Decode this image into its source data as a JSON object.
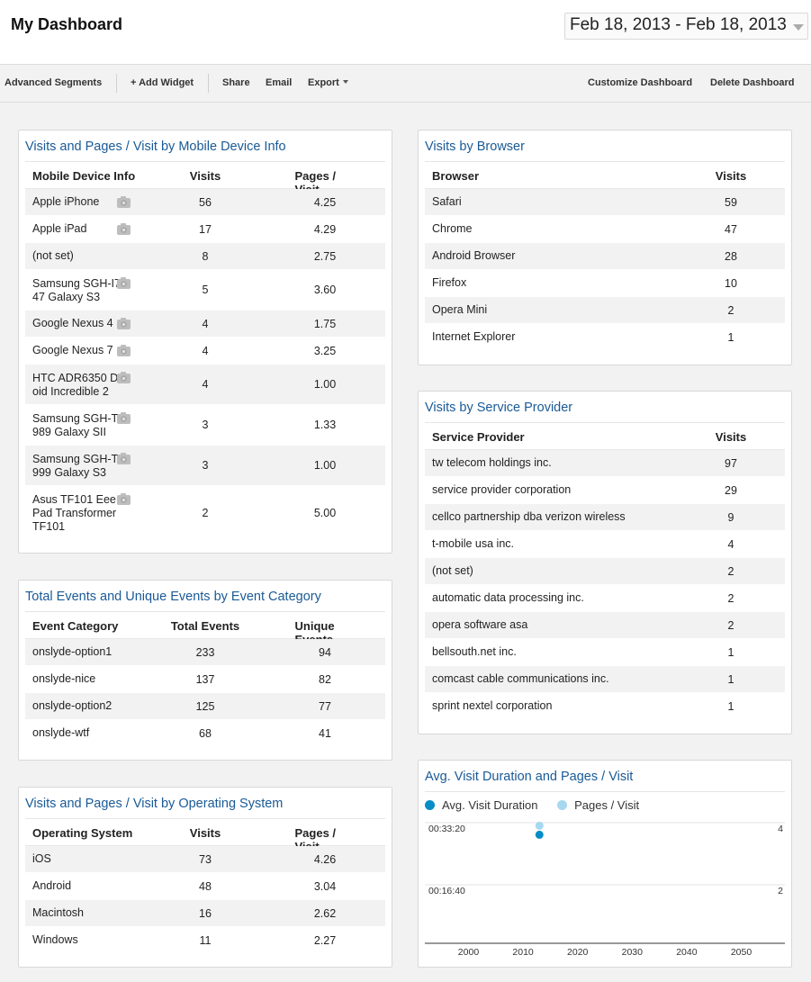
{
  "header": {
    "title": "My Dashboard",
    "date_range": "Feb 18, 2013 - Feb 18, 2013"
  },
  "toolbar": {
    "advanced_segments": "Advanced Segments",
    "add_widget": "+ Add Widget",
    "share": "Share",
    "email": "Email",
    "export": "Export",
    "customize": "Customize Dashboard",
    "delete": "Delete Dashboard"
  },
  "widgets": {
    "mobile": {
      "title": "Visits and Pages / Visit by Mobile Device Info",
      "headers": [
        "Mobile Device Info",
        "Visits",
        "Pages / Visit"
      ],
      "rows": [
        {
          "name": [
            "Apple iPhone"
          ],
          "visits": "56",
          "ppv": "4.25",
          "camera": true
        },
        {
          "name": [
            "Apple iPad"
          ],
          "visits": "17",
          "ppv": "4.29",
          "camera": true
        },
        {
          "name": [
            "(not set)"
          ],
          "visits": "8",
          "ppv": "2.75",
          "camera": false
        },
        {
          "name": [
            "Samsung SGH-I7",
            "47 Galaxy S3"
          ],
          "visits": "5",
          "ppv": "3.60",
          "camera": true
        },
        {
          "name": [
            "Google Nexus 4"
          ],
          "visits": "4",
          "ppv": "1.75",
          "camera": true
        },
        {
          "name": [
            "Google Nexus 7"
          ],
          "visits": "4",
          "ppv": "3.25",
          "camera": true
        },
        {
          "name": [
            "HTC ADR6350 Dr",
            "oid Incredible 2"
          ],
          "visits": "4",
          "ppv": "1.00",
          "camera": true
        },
        {
          "name": [
            "Samsung SGH-T",
            "989 Galaxy SII"
          ],
          "visits": "3",
          "ppv": "1.33",
          "camera": true
        },
        {
          "name": [
            "Samsung SGH-T",
            "999 Galaxy S3"
          ],
          "visits": "3",
          "ppv": "1.00",
          "camera": true
        },
        {
          "name": [
            "Asus TF101 Eee",
            "Pad Transformer",
            "TF101"
          ],
          "visits": "2",
          "ppv": "5.00",
          "camera": true
        }
      ]
    },
    "events": {
      "title": "Total Events and Unique Events by Event Category",
      "headers": [
        "Event Category",
        "Total Events",
        "Unique Events"
      ],
      "rows": [
        {
          "name": [
            "onslyde-option1"
          ],
          "total": "233",
          "unique": "94"
        },
        {
          "name": [
            "onslyde-nice"
          ],
          "total": "137",
          "unique": "82"
        },
        {
          "name": [
            "onslyde-option2"
          ],
          "total": "125",
          "unique": "77"
        },
        {
          "name": [
            "onslyde-wtf"
          ],
          "total": "68",
          "unique": "41"
        }
      ]
    },
    "os": {
      "title": "Visits and Pages / Visit by Operating System",
      "headers": [
        "Operating System",
        "Visits",
        "Pages / Visit"
      ],
      "rows": [
        {
          "name": [
            "iOS"
          ],
          "visits": "73",
          "ppv": "4.26"
        },
        {
          "name": [
            "Android"
          ],
          "visits": "48",
          "ppv": "3.04"
        },
        {
          "name": [
            "Macintosh"
          ],
          "visits": "16",
          "ppv": "2.62"
        },
        {
          "name": [
            "Windows"
          ],
          "visits": "11",
          "ppv": "2.27"
        }
      ]
    },
    "browser": {
      "title": "Visits by Browser",
      "headers": [
        "Browser",
        "Visits"
      ],
      "rows": [
        {
          "name": [
            "Safari"
          ],
          "visits": "59"
        },
        {
          "name": [
            "Chrome"
          ],
          "visits": "47"
        },
        {
          "name": [
            "Android Browser"
          ],
          "visits": "28"
        },
        {
          "name": [
            "Firefox"
          ],
          "visits": "10"
        },
        {
          "name": [
            "Opera Mini"
          ],
          "visits": "2"
        },
        {
          "name": [
            "Internet Explorer"
          ],
          "visits": "1"
        }
      ]
    },
    "provider": {
      "title": "Visits by Service Provider",
      "headers": [
        "Service Provider",
        "Visits"
      ],
      "rows": [
        {
          "name": [
            "tw telecom holdings inc."
          ],
          "visits": "97"
        },
        {
          "name": [
            "service provider corporation"
          ],
          "visits": "29"
        },
        {
          "name": [
            "cellco partnership dba verizon wireless"
          ],
          "visits": "9"
        },
        {
          "name": [
            "t-mobile usa inc."
          ],
          "visits": "4"
        },
        {
          "name": [
            "(not set)"
          ],
          "visits": "2"
        },
        {
          "name": [
            "automatic data processing inc."
          ],
          "visits": "2"
        },
        {
          "name": [
            "opera software asa"
          ],
          "visits": "2"
        },
        {
          "name": [
            "bellsouth.net inc."
          ],
          "visits": "1"
        },
        {
          "name": [
            "comcast cable communications inc."
          ],
          "visits": "1"
        },
        {
          "name": [
            "sprint nextel corporation"
          ],
          "visits": "1"
        }
      ]
    },
    "duration": {
      "title": "Avg. Visit Duration and Pages / Visit"
    }
  },
  "colors": {
    "link": "#1a5a96",
    "series_dark": "#058dc7",
    "series_light": "#a6d8f0"
  },
  "chart_data": {
    "type": "scatter",
    "title": "Avg. Visit Duration and Pages / Visit",
    "x_ticks": [
      "2000",
      "2010",
      "2020",
      "2030",
      "2040",
      "2050"
    ],
    "xlim": [
      1992,
      2058
    ],
    "y_left_ticks": [
      "00:33:20",
      "00:16:40"
    ],
    "y_right_ticks": [
      "4",
      "2"
    ],
    "legend_position": "top-left",
    "grid": true,
    "series": [
      {
        "name": "Avg. Visit Duration",
        "color": "#058dc7",
        "axis": "left",
        "points": [
          {
            "x": 2013,
            "y_seconds": 1800
          }
        ]
      },
      {
        "name": "Pages / Visit",
        "color": "#a6d8f0",
        "axis": "right",
        "points": [
          {
            "x": 2013,
            "y": 3.9
          }
        ]
      }
    ]
  }
}
